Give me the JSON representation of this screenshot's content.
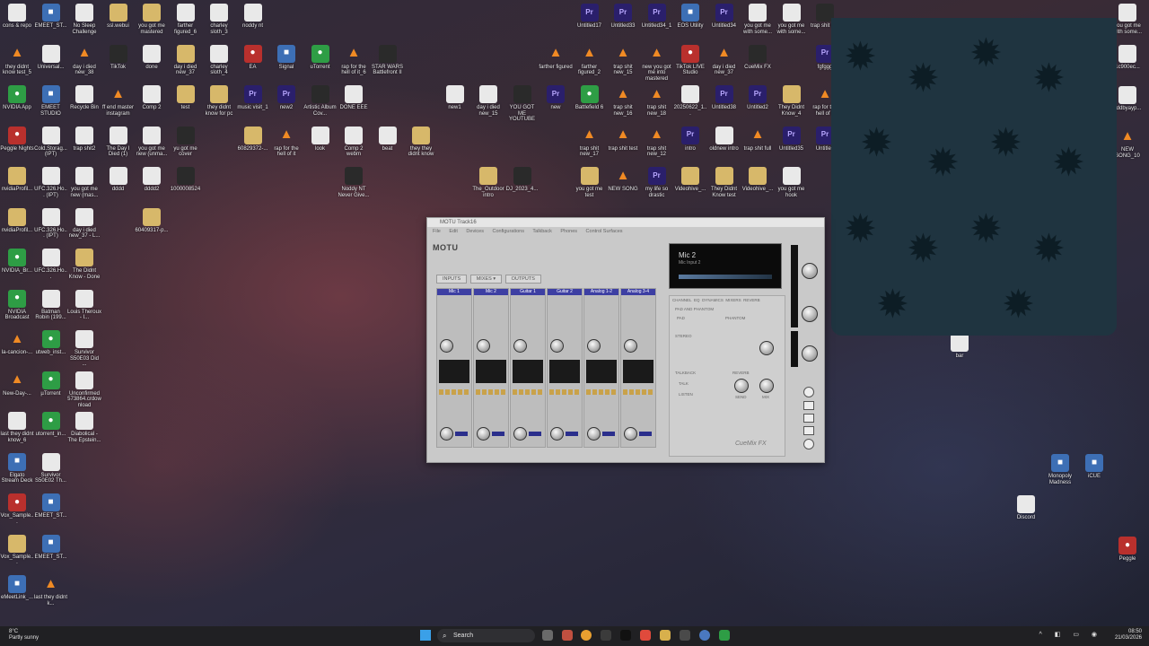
{
  "desktop_icons": [
    {
      "label": "cons & repo",
      "type": "file",
      "x": 0,
      "y": 0
    },
    {
      "label": "EMEET_ST...",
      "type": "app",
      "x": 1,
      "y": 0
    },
    {
      "label": "No Sleep Challenge",
      "type": "file",
      "x": 2,
      "y": 0
    },
    {
      "label": "ssl.webui",
      "type": "folder",
      "x": 3,
      "y": 0
    },
    {
      "label": "you got me mastered",
      "type": "folder",
      "x": 4,
      "y": 0
    },
    {
      "label": "farther figured_6",
      "type": "file",
      "x": 5,
      "y": 0
    },
    {
      "label": "charley sloth_3",
      "type": "file",
      "x": 6,
      "y": 0
    },
    {
      "label": "noddy nt",
      "type": "file",
      "x": 7,
      "y": 0
    },
    {
      "label": "Untitled17",
      "type": "pr",
      "x": 17,
      "y": 0
    },
    {
      "label": "Untitled33",
      "type": "pr",
      "x": 18,
      "y": 0
    },
    {
      "label": "Untitled34_1",
      "type": "pr",
      "x": 19,
      "y": 0
    },
    {
      "label": "EOS Utility",
      "type": "app",
      "x": 20,
      "y": 0
    },
    {
      "label": "Untitled34",
      "type": "pr",
      "x": 21,
      "y": 0
    },
    {
      "label": "you got me with some...",
      "type": "file",
      "x": 22,
      "y": 0
    },
    {
      "label": "you got me with some...",
      "type": "file",
      "x": 23,
      "y": 0
    },
    {
      "label": "trap shit wip",
      "type": "dark",
      "x": 24,
      "y": 0
    },
    {
      "label": "they didnt know test_5",
      "type": "vlc",
      "x": 0,
      "y": 1
    },
    {
      "label": "Universal...",
      "type": "file",
      "x": 1,
      "y": 1
    },
    {
      "label": "day i died new_38",
      "type": "vlc",
      "x": 2,
      "y": 1
    },
    {
      "label": "TikTok",
      "type": "dark",
      "x": 3,
      "y": 1
    },
    {
      "label": "done",
      "type": "file",
      "x": 4,
      "y": 1
    },
    {
      "label": "day i died new_37",
      "type": "folder",
      "x": 5,
      "y": 1
    },
    {
      "label": "charley sloth_4",
      "type": "file",
      "x": 6,
      "y": 1
    },
    {
      "label": "EA",
      "type": "red",
      "x": 7,
      "y": 1
    },
    {
      "label": "Signal",
      "type": "app",
      "x": 8,
      "y": 1
    },
    {
      "label": "uTorrent",
      "type": "green",
      "x": 9,
      "y": 1
    },
    {
      "label": "rap for the hell of it_6",
      "type": "vlc",
      "x": 10,
      "y": 1
    },
    {
      "label": "STAR WARS Battlefront II",
      "type": "dark",
      "x": 11,
      "y": 1
    },
    {
      "label": "farther figured",
      "type": "vlc",
      "x": 16,
      "y": 1
    },
    {
      "label": "farther figured_2",
      "type": "vlc",
      "x": 17,
      "y": 1
    },
    {
      "label": "trap shit new_15",
      "type": "vlc",
      "x": 18,
      "y": 1
    },
    {
      "label": "new you got me into mastered",
      "type": "vlc",
      "x": 19,
      "y": 1
    },
    {
      "label": "TikTok LIVE Studio",
      "type": "red",
      "x": 20,
      "y": 1
    },
    {
      "label": "day i died new_37",
      "type": "vlc",
      "x": 21,
      "y": 1
    },
    {
      "label": "CueMix FX",
      "type": "dark",
      "x": 22,
      "y": 1
    },
    {
      "label": "fgfggg",
      "type": "pr",
      "x": 24,
      "y": 1
    },
    {
      "label": "NVIDIA App",
      "type": "green",
      "x": 0,
      "y": 2
    },
    {
      "label": "EMEET STUDIO",
      "type": "app",
      "x": 1,
      "y": 2
    },
    {
      "label": "Recycle Bin",
      "type": "file",
      "x": 2,
      "y": 2
    },
    {
      "label": "ff end master instagram",
      "type": "vlc",
      "x": 3,
      "y": 2
    },
    {
      "label": "Comp 2",
      "type": "file",
      "x": 4,
      "y": 2
    },
    {
      "label": "test",
      "type": "folder",
      "x": 5,
      "y": 2
    },
    {
      "label": "they didnt know for pc",
      "type": "folder",
      "x": 6,
      "y": 2
    },
    {
      "label": "music visit_1",
      "type": "pr",
      "x": 7,
      "y": 2
    },
    {
      "label": "new2",
      "type": "pr",
      "x": 8,
      "y": 2
    },
    {
      "label": "Artistic Album Cov...",
      "type": "dark",
      "x": 9,
      "y": 2
    },
    {
      "label": "DONE EEE",
      "type": "file",
      "x": 10,
      "y": 2
    },
    {
      "label": "new1",
      "type": "file",
      "x": 13,
      "y": 2
    },
    {
      "label": "day i died new_15",
      "type": "file",
      "x": 14,
      "y": 2
    },
    {
      "label": "YOU GOT ME YOUTUBE",
      "type": "dark",
      "x": 15,
      "y": 2
    },
    {
      "label": "new",
      "type": "pr",
      "x": 16,
      "y": 2
    },
    {
      "label": "Battlefield 6",
      "type": "green",
      "x": 17,
      "y": 2
    },
    {
      "label": "trap shit new_16",
      "type": "vlc",
      "x": 18,
      "y": 2
    },
    {
      "label": "trap shit new_18",
      "type": "vlc",
      "x": 19,
      "y": 2
    },
    {
      "label": "20250622_1...",
      "type": "file",
      "x": 20,
      "y": 2
    },
    {
      "label": "Untitled38",
      "type": "pr",
      "x": 21,
      "y": 2
    },
    {
      "label": "Untitled2",
      "type": "pr",
      "x": 22,
      "y": 2
    },
    {
      "label": "They Didnt Know_4",
      "type": "folder",
      "x": 23,
      "y": 2
    },
    {
      "label": "rap for the hell of it",
      "type": "vlc",
      "x": 24,
      "y": 2
    },
    {
      "label": "Peggle Nights",
      "type": "red",
      "x": 0,
      "y": 3
    },
    {
      "label": "Cold.Storag... (IPT)",
      "type": "file",
      "x": 1,
      "y": 3
    },
    {
      "label": "trap shit2",
      "type": "file",
      "x": 2,
      "y": 3
    },
    {
      "label": "The Day I Died (1)",
      "type": "file",
      "x": 3,
      "y": 3
    },
    {
      "label": "you got me new (unma...",
      "type": "file",
      "x": 4,
      "y": 3
    },
    {
      "label": "yu got me cover",
      "type": "dark",
      "x": 5,
      "y": 3
    },
    {
      "label": "60829372-...",
      "type": "folder",
      "x": 7,
      "y": 3
    },
    {
      "label": "rap for the hell of it",
      "type": "vlc",
      "x": 8,
      "y": 3
    },
    {
      "label": "look",
      "type": "file",
      "x": 9,
      "y": 3
    },
    {
      "label": "Comp 2 webm",
      "type": "file",
      "x": 10,
      "y": 3
    },
    {
      "label": "beat",
      "type": "file",
      "x": 11,
      "y": 3
    },
    {
      "label": "they they didnt know",
      "type": "folder",
      "x": 12,
      "y": 3
    },
    {
      "label": "trap shit new_17",
      "type": "vlc",
      "x": 17,
      "y": 3
    },
    {
      "label": "trap shit test",
      "type": "vlc",
      "x": 18,
      "y": 3
    },
    {
      "label": "trap shit new_12",
      "type": "vlc",
      "x": 19,
      "y": 3
    },
    {
      "label": "intro",
      "type": "pr",
      "x": 20,
      "y": 3
    },
    {
      "label": "oldnew intro",
      "type": "file",
      "x": 21,
      "y": 3
    },
    {
      "label": "trap shit full",
      "type": "vlc",
      "x": 22,
      "y": 3
    },
    {
      "label": "Untitled35",
      "type": "pr",
      "x": 23,
      "y": 3
    },
    {
      "label": "Untitled",
      "type": "pr",
      "x": 24,
      "y": 3
    },
    {
      "label": "nvidiaProfil...",
      "type": "folder",
      "x": 0,
      "y": 4
    },
    {
      "label": "UFC.326.Ho... (IPT)",
      "type": "file",
      "x": 1,
      "y": 4
    },
    {
      "label": "you got me new (mas...",
      "type": "file",
      "x": 2,
      "y": 4
    },
    {
      "label": "dddd",
      "type": "file",
      "x": 3,
      "y": 4
    },
    {
      "label": "dddd2",
      "type": "file",
      "x": 4,
      "y": 4
    },
    {
      "label": "1000008524",
      "type": "dark",
      "x": 5,
      "y": 4
    },
    {
      "label": "Noddy NT Never Give...",
      "type": "dark",
      "x": 10,
      "y": 4
    },
    {
      "label": "The_Outdoor intro",
      "type": "folder",
      "x": 14,
      "y": 4
    },
    {
      "label": "DJ_2023_4...",
      "type": "dark",
      "x": 15,
      "y": 4
    },
    {
      "label": "you got me test",
      "type": "folder",
      "x": 17,
      "y": 4
    },
    {
      "label": "NEW SONG",
      "type": "vlc",
      "x": 18,
      "y": 4
    },
    {
      "label": "my life so drastic",
      "type": "pr",
      "x": 19,
      "y": 4
    },
    {
      "label": "Videohive_...",
      "type": "folder",
      "x": 20,
      "y": 4
    },
    {
      "label": "They Didnt Know test",
      "type": "folder",
      "x": 21,
      "y": 4
    },
    {
      "label": "Videohive_...",
      "type": "folder",
      "x": 22,
      "y": 4
    },
    {
      "label": "you got me hook",
      "type": "file",
      "x": 23,
      "y": 4
    },
    {
      "label": "nvidiaProfil...",
      "type": "folder",
      "x": 0,
      "y": 5
    },
    {
      "label": "UFC.326.Ho... (IPT)",
      "type": "file",
      "x": 1,
      "y": 5
    },
    {
      "label": "day i died new_37 - L...",
      "type": "file",
      "x": 2,
      "y": 5
    },
    {
      "label": "60409317-p...",
      "type": "folder",
      "x": 4,
      "y": 5
    },
    {
      "label": "NVIDIA_Br...",
      "type": "green",
      "x": 0,
      "y": 6
    },
    {
      "label": "UFC.326.Ho...",
      "type": "file",
      "x": 1,
      "y": 6
    },
    {
      "label": "The Didnt Know - Done",
      "type": "folder",
      "x": 2,
      "y": 6
    },
    {
      "label": "NVIDIA Broadcast",
      "type": "green",
      "x": 0,
      "y": 7
    },
    {
      "label": "Batman Robin (199...",
      "type": "file",
      "x": 1,
      "y": 7
    },
    {
      "label": "Louis Theroux - I...",
      "type": "file",
      "x": 2,
      "y": 7
    },
    {
      "label": "la-cancion-...",
      "type": "vlc",
      "x": 0,
      "y": 8
    },
    {
      "label": "utweb_inst...",
      "type": "green",
      "x": 1,
      "y": 8
    },
    {
      "label": "Survivor S50E03 Did ...",
      "type": "file",
      "x": 2,
      "y": 8
    },
    {
      "label": "New-Day-...",
      "type": "vlc",
      "x": 0,
      "y": 9
    },
    {
      "label": "µTorrent",
      "type": "green",
      "x": 1,
      "y": 9
    },
    {
      "label": "Unconfirmed 573864.crdownload",
      "type": "file",
      "x": 2,
      "y": 9
    },
    {
      "label": "last they didnt know_6",
      "type": "file",
      "x": 0,
      "y": 10
    },
    {
      "label": "utorrent_in...",
      "type": "green",
      "x": 1,
      "y": 10
    },
    {
      "label": "Diabolical - The Epstein...",
      "type": "file",
      "x": 2,
      "y": 10
    },
    {
      "label": "Elgato Stream Deck",
      "type": "app",
      "x": 0,
      "y": 11
    },
    {
      "label": "Survivor S50E02 Th...",
      "type": "file",
      "x": 1,
      "y": 11
    },
    {
      "label": "Vox_Sample...",
      "type": "red",
      "x": 0,
      "y": 12
    },
    {
      "label": "EMEET_ST...",
      "type": "app",
      "x": 1,
      "y": 12
    },
    {
      "label": "Vox_Sample...",
      "type": "folder",
      "x": 0,
      "y": 13
    },
    {
      "label": "EMEET_ST...",
      "type": "app",
      "x": 1,
      "y": 13
    },
    {
      "label": "eMeetLink_...",
      "type": "app",
      "x": 0,
      "y": 14
    },
    {
      "label": "last they didnt k...",
      "type": "vlc",
      "x": 1,
      "y": 14
    }
  ],
  "right_icons": [
    {
      "label": "you got me with some...",
      "type": "file",
      "pos": "r1"
    },
    {
      "label": "1c900ec...",
      "type": "file",
      "pos": "r2"
    },
    {
      "label": "sddbyayp...",
      "type": "file",
      "pos": "r3"
    },
    {
      "label": "NEW SONG_10",
      "type": "vlc",
      "pos": "r4"
    },
    {
      "label": "bar",
      "type": "file",
      "pos": "r5"
    },
    {
      "label": "Monopoly Madness",
      "type": "app",
      "pos": "r6"
    },
    {
      "label": "iCUE",
      "type": "app",
      "pos": "r7"
    },
    {
      "label": "Discord",
      "type": "file",
      "pos": "r8"
    },
    {
      "label": "Peggle",
      "type": "red",
      "pos": "r9"
    }
  ],
  "motu_window": {
    "title": "MOTU Track16",
    "menu": [
      "File",
      "Edit",
      "Devices",
      "Configurations",
      "Talkback",
      "Phones",
      "Control Surfaces"
    ],
    "brand": "MOTU",
    "tabs": [
      "INPUTS",
      "MIXES ▾",
      "OUTPUTS"
    ],
    "channels": [
      "Mic 1",
      "Mic 2",
      "Guitar 1",
      "Guitar 2",
      "Analog 1-2",
      "Analog 3-4"
    ],
    "display_line1": "Mic 2",
    "display_line2": "Mic Input 2",
    "panel_tabs": [
      "CHANNEL",
      "EQ",
      "DYNAMICS",
      "MIXERS",
      "REVERB"
    ],
    "section_pad": "PAD AND PHANTOM",
    "pad_label": "PAD",
    "phantom_label": "PHANTOM",
    "stereo_label": "STEREO",
    "talkback_label": "TALKBACK",
    "reverb_label": "REVERB",
    "talk_label": "TALK",
    "listen_label": "LISTEN",
    "send_label": "SEND",
    "mix_label": "MIX",
    "footer_brand": "CueMix FX"
  },
  "taskbar": {
    "weather_temp": "8°C",
    "weather_desc": "Partly sunny",
    "search_placeholder": "Search",
    "time": "08:50",
    "date": "21/03/2026"
  },
  "colors": {
    "taskbar_bg": "#202023",
    "overlay_bg": "#1f3440",
    "channel_name_bg": "#3d3fa3"
  }
}
